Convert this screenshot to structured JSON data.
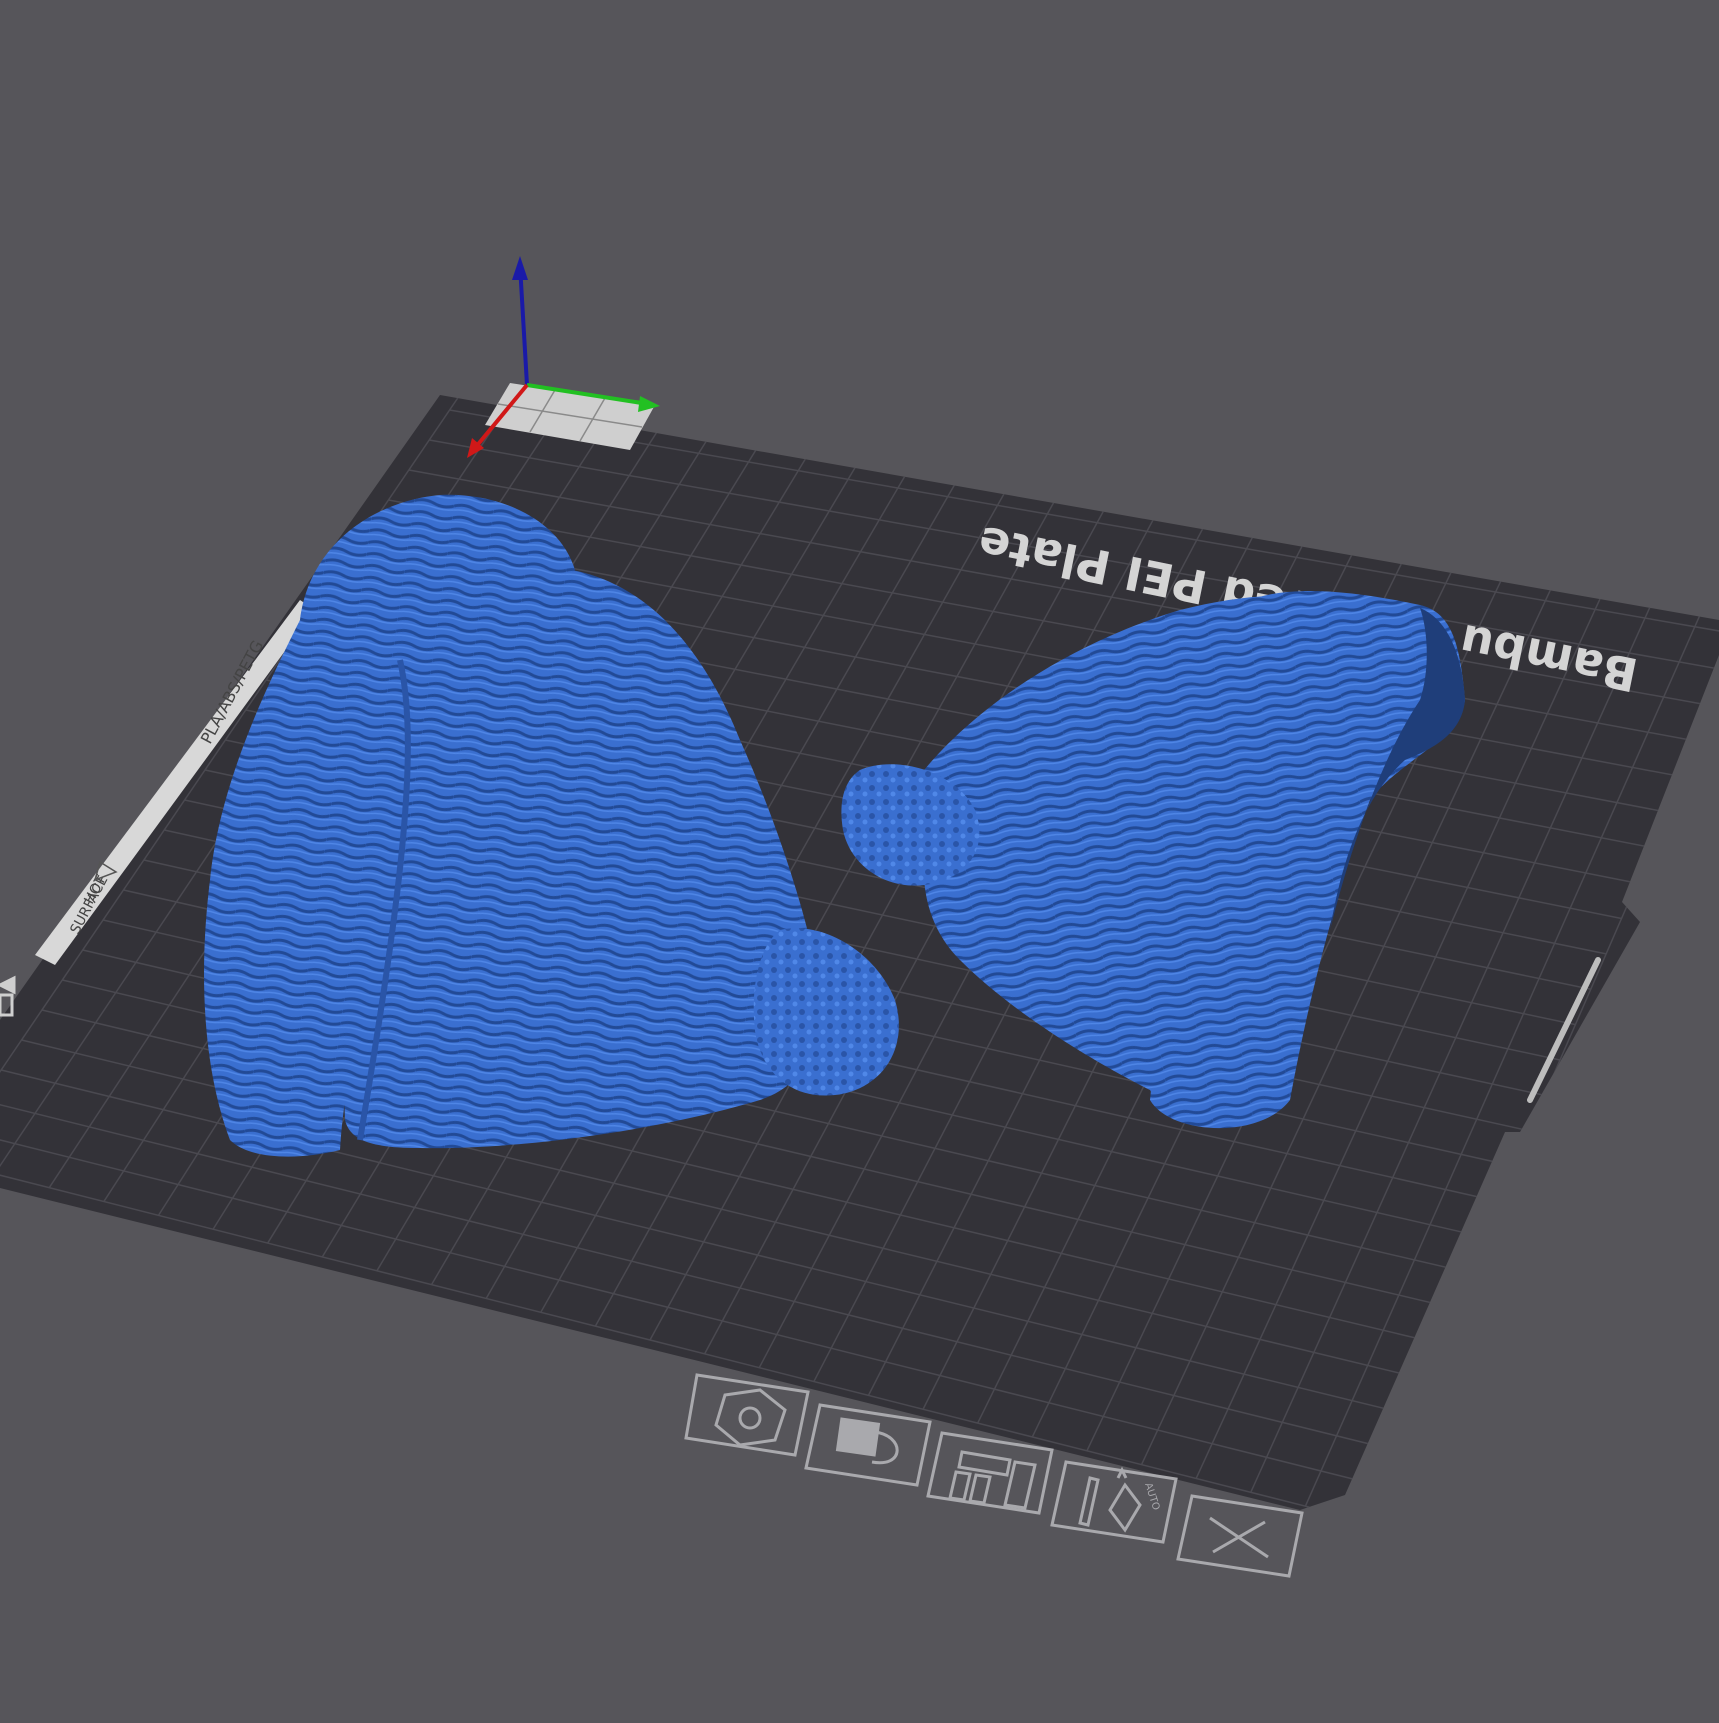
{
  "viewport": {
    "plate_label": "Bambu Textured PEI Plate",
    "side_text_1": "PLA/ABS/PETG",
    "side_text_2": "HOT",
    "side_text_3": "SURFACE",
    "auto_text": "AUTO"
  },
  "colors": {
    "background": "#56555a",
    "plate": "#333238",
    "grid": "#4b4a50",
    "model": "#3a6fd0",
    "axis_x": "#d01818",
    "axis_y": "#22c022",
    "axis_z": "#1a1aa8"
  },
  "plate_toolbar": [
    {
      "name": "orient-button",
      "icon": "hexagon-icon"
    },
    {
      "name": "lock-button",
      "icon": "lock-icon"
    },
    {
      "name": "arrange-button",
      "icon": "arrange-icon"
    },
    {
      "name": "auto-orient-button",
      "icon": "auto-orient-icon"
    },
    {
      "name": "delete-plate-button",
      "icon": "close-icon"
    }
  ],
  "models": [
    {
      "name": "beanie-model-left"
    },
    {
      "name": "beanie-model-right"
    }
  ]
}
